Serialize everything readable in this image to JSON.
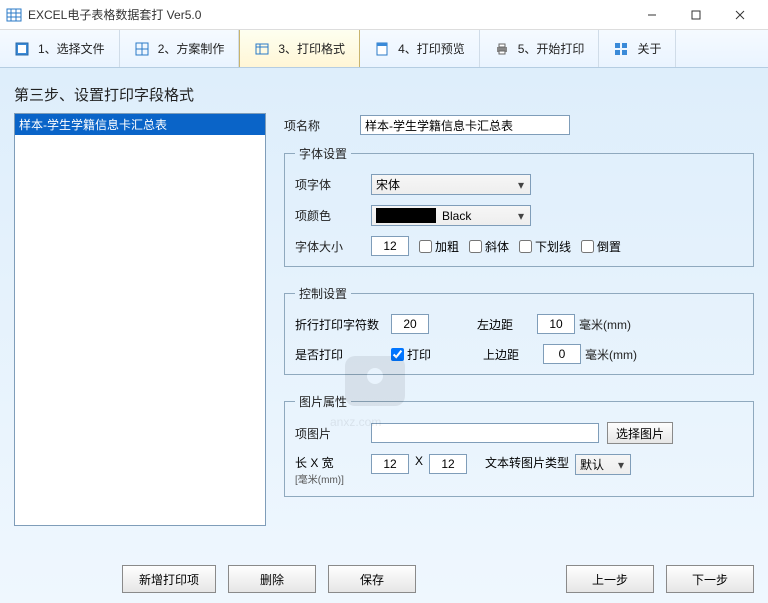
{
  "window": {
    "title": "EXCEL电子表格数据套打 Ver5.0"
  },
  "toolbar": {
    "items": [
      {
        "label": "1、选择文件"
      },
      {
        "label": "2、方案制作"
      },
      {
        "label": "3、打印格式"
      },
      {
        "label": "4、打印预览"
      },
      {
        "label": "5、开始打印"
      },
      {
        "label": "关于"
      }
    ]
  },
  "step_title": "第三步、设置打印字段格式",
  "list": {
    "items": [
      {
        "label": "样本-学生学籍信息卡汇总表"
      }
    ]
  },
  "form": {
    "name_label": "项名称",
    "name_value": "样本-学生学籍信息卡汇总表",
    "font_group": "字体设置",
    "font_label": "项字体",
    "font_value": "宋体",
    "color_label": "项颜色",
    "color_value": "Black",
    "size_label": "字体大小",
    "size_value": "12",
    "bold": "加粗",
    "italic": "斜体",
    "underline": "下划线",
    "reverse": "倒置",
    "ctrl_group": "控制设置",
    "wrap_label": "折行打印字符数",
    "wrap_value": "20",
    "left_label": "左边距",
    "left_value": "10",
    "unit_mm": "毫米(mm)",
    "print_label": "是否打印",
    "print_check": "打印",
    "top_label": "上边距",
    "top_value": "0",
    "img_group": "图片属性",
    "img_label": "项图片",
    "select_img": "选择图片",
    "lw_label": "长 X 宽",
    "lw_sub": "[毫米(mm)]",
    "len_value": "12",
    "wid_value": "12",
    "x_sep": "X",
    "txt2img_label": "文本转图片类型",
    "txt2img_value": "默认"
  },
  "buttons": {
    "add": "新增打印项",
    "delete": "删除",
    "save": "保存",
    "prev": "上一步",
    "next": "下一步"
  }
}
